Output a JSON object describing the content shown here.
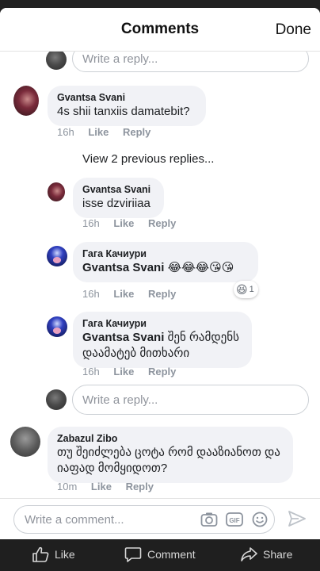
{
  "header": {
    "title": "Comments",
    "done_label": "Done"
  },
  "top_reply_input": {
    "placeholder": "Write a reply..."
  },
  "comments": [
    {
      "author": "Gvantsa Svani",
      "text": "4s shii tanxiis damatebit?",
      "time": "16h",
      "like": "Like",
      "reply": "Reply"
    },
    {
      "author": "Zabazul Zibo",
      "text": "თუ შეიძლება ცოტა რომ დააზიანოთ და იაფად მომყიდოთ?",
      "time": "10m",
      "like": "Like",
      "reply": "Reply"
    }
  ],
  "view_previous": "View 2 previous replies...",
  "replies": [
    {
      "author": "Gvantsa Svani",
      "text": "isse dzviriiaa",
      "time": "16h",
      "like": "Like",
      "reply": "Reply"
    },
    {
      "author": "Гага Качиури",
      "mention": "Gvantsa Svani",
      "text": "😂😂😂😘😘",
      "time": "16h",
      "like": "Like",
      "reply": "Reply",
      "reaction": {
        "emoji": "😆",
        "count": "1"
      }
    },
    {
      "author": "Гага Качиури",
      "mention": "Gvantsa Svani",
      "text": "შენ რამდენს დაამატებ მითხარი",
      "time": "16h",
      "like": "Like",
      "reply": "Reply"
    }
  ],
  "reply_input": {
    "placeholder": "Write a reply..."
  },
  "composer": {
    "placeholder": "Write a comment...",
    "icons": [
      "camera-icon",
      "gif-icon",
      "emoji-icon",
      "send-icon"
    ]
  },
  "tabbar": {
    "like_label": "Like",
    "comment_label": "Comment",
    "share_label": "Share"
  }
}
